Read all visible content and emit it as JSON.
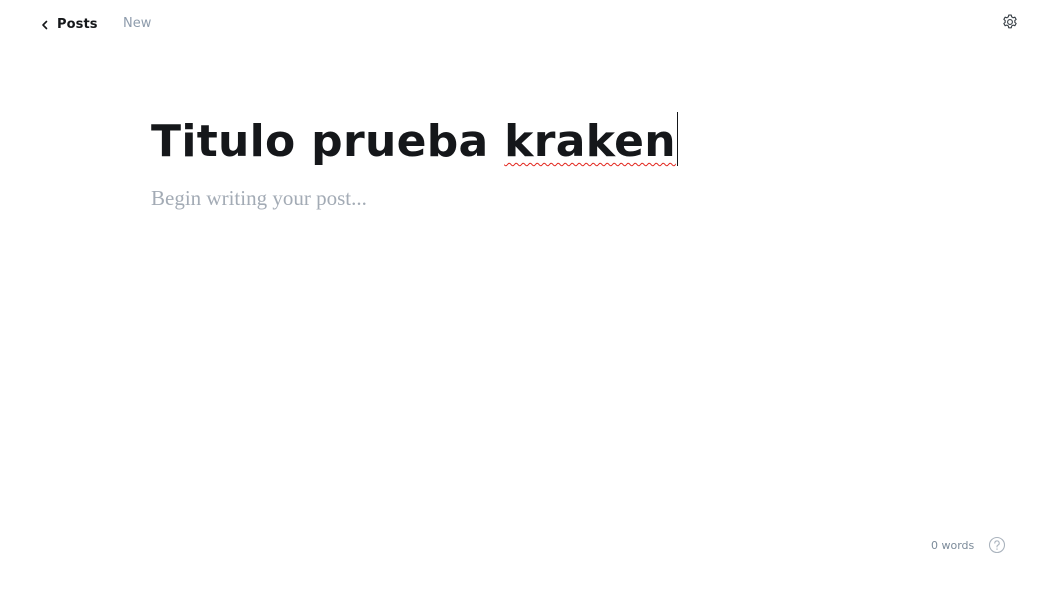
{
  "header": {
    "back_label": "Posts",
    "status": "New"
  },
  "editor": {
    "title_text": "Titulo prueba ",
    "title_misspelled": "kraken",
    "body_placeholder": "Begin writing your post..."
  },
  "footer": {
    "word_count": "0 words"
  },
  "icons": {
    "back": "chevron-left-icon",
    "settings": "gear-icon",
    "help": "question-circle-icon"
  },
  "colors": {
    "text": "#15171a",
    "muted": "#8e9cac",
    "placeholder": "#a3abb5",
    "spellcheck": "#e2231a"
  }
}
